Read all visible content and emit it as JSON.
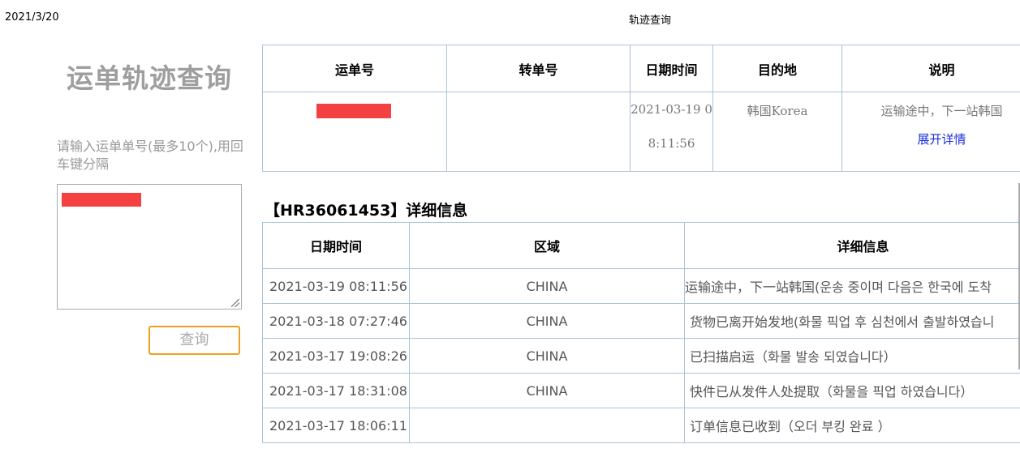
{
  "print_header": {
    "date": "2021/3/20",
    "title": "轨迹查询"
  },
  "sidebar": {
    "title": "运单轨迹查询",
    "hint": "请输入运单单号(最多10个),用回车键分隔",
    "query_button": "查询"
  },
  "summary_table": {
    "headers": [
      "运单号",
      "转单号",
      "日期时间",
      "目的地",
      "说明"
    ],
    "row": {
      "transfer_no": "",
      "datetime": "2021-03-19 08:11:56",
      "destination": "韩国Korea",
      "description": "运输途中，下一站韩国",
      "expand_link": "展开详情"
    }
  },
  "detail": {
    "title": "【HR36061453】详细信息",
    "headers": [
      "日期时间",
      "区域",
      "详细信息"
    ],
    "rows": [
      {
        "datetime": "2021-03-19 08:11:56",
        "region": "CHINA",
        "info": "运输途中，下一站韩国(운송 중이며 다음은 한국에 도착"
      },
      {
        "datetime": "2021-03-18 07:27:46",
        "region": "CHINA",
        "info": "货物已离开始发地(화물 픽업 후 심천에서 출발하였습니"
      },
      {
        "datetime": "2021-03-17 19:08:26",
        "region": "CHINA",
        "info": "已扫描启运（화물 발송 되였습니다）"
      },
      {
        "datetime": "2021-03-17 18:31:08",
        "region": "CHINA",
        "info": "快件已从发件人处提取（화물을 픽업 하였습니다）"
      },
      {
        "datetime": "2021-03-17 18:06:11",
        "region": "",
        "info": "订单信息已收到（오더 부킹 완료 ）"
      }
    ]
  },
  "colors": {
    "accent_button_border": "#f0a020",
    "link": "#1a2fd8",
    "table_border": "#a9c4d6",
    "redaction": "#f44040"
  }
}
